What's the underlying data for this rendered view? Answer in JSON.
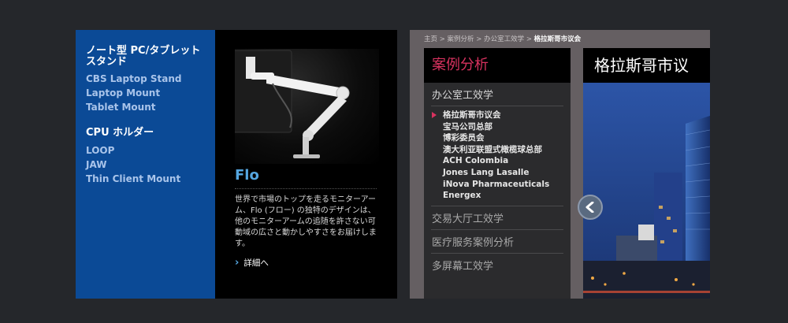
{
  "left_panel": {
    "categories": [
      {
        "heading": "ノート型 PC/タブレット スタンド",
        "links": [
          "CBS Laptop Stand",
          "Laptop Mount",
          "Tablet Mount"
        ]
      },
      {
        "heading": "CPU ホルダー",
        "links": [
          "LOOP",
          "JAW",
          "Thin Client Mount"
        ]
      }
    ],
    "product": {
      "title": "Flo",
      "description": "世界で市場のトップを走るモニターアーム、Flo (フロー) の独特のデザインは、他のモニターアームの追随を許さない可動域の広さと動かしやすさをお届けします。",
      "details_link": "詳細へ",
      "image_icon": "monitor-arm-photo"
    },
    "colors": {
      "sidebar": "#0b4a96",
      "accent": "#55a6e0"
    }
  },
  "right_panel": {
    "breadcrumb": [
      "主页",
      "案例分析",
      "办公室工效学"
    ],
    "breadcrumb_separator": ">",
    "breadcrumb_current": "格拉斯哥市议会",
    "menu": {
      "header": "案例分析",
      "section_active": "办公室工效学",
      "items": [
        "格拉斯哥市议会",
        "宝马公司总部",
        "博彩委员会",
        "澳大利亚联盟式橄榄球总部",
        "ACH Colombia",
        "Jones Lang Lasalle",
        "iNova Pharmaceuticals",
        "Energex"
      ],
      "active_item": "格拉斯哥市议会",
      "sections_other": [
        "交易大厅工效学",
        "医疗服务案例分析",
        "多屏幕工效学"
      ]
    },
    "case_title": "格拉斯哥市议",
    "prev_icon": "chevron-left-icon",
    "colors": {
      "accent": "#d8325f",
      "panel": "#655f62"
    }
  }
}
